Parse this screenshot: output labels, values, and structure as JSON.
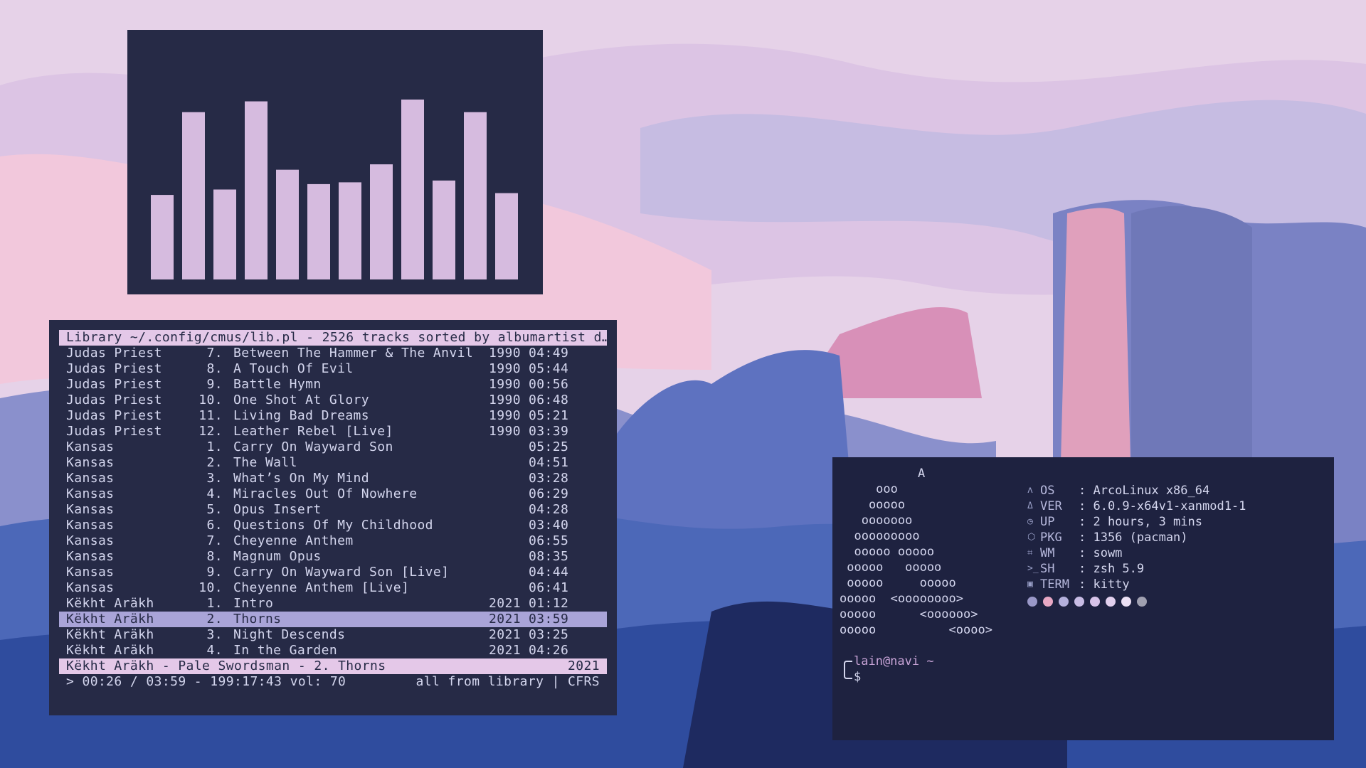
{
  "cmus": {
    "header": "Library ~/.config/cmus/lib.pl - 2526 tracks sorted by albumartist d…",
    "tracks": [
      {
        "artist": "Judas Priest",
        "num": "7.",
        "title": "Between The Hammer & The Anvil",
        "year": "1990",
        "time": "04:49"
      },
      {
        "artist": "Judas Priest",
        "num": "8.",
        "title": "A Touch Of Evil",
        "year": "1990",
        "time": "05:44"
      },
      {
        "artist": "Judas Priest",
        "num": "9.",
        "title": "Battle Hymn",
        "year": "1990",
        "time": "00:56"
      },
      {
        "artist": "Judas Priest",
        "num": "10.",
        "title": "One Shot At Glory",
        "year": "1990",
        "time": "06:48"
      },
      {
        "artist": "Judas Priest",
        "num": "11.",
        "title": "Living Bad Dreams",
        "year": "1990",
        "time": "05:21"
      },
      {
        "artist": "Judas Priest",
        "num": "12.",
        "title": "Leather Rebel [Live]",
        "year": "1990",
        "time": "03:39"
      },
      {
        "artist": "Kansas",
        "num": "1.",
        "title": "Carry On Wayward Son",
        "year": "",
        "time": "05:25"
      },
      {
        "artist": "Kansas",
        "num": "2.",
        "title": "The Wall",
        "year": "",
        "time": "04:51"
      },
      {
        "artist": "Kansas",
        "num": "3.",
        "title": "What’s On My Mind",
        "year": "",
        "time": "03:28"
      },
      {
        "artist": "Kansas",
        "num": "4.",
        "title": "Miracles Out Of Nowhere",
        "year": "",
        "time": "06:29"
      },
      {
        "artist": "Kansas",
        "num": "5.",
        "title": "Opus Insert",
        "year": "",
        "time": "04:28"
      },
      {
        "artist": "Kansas",
        "num": "6.",
        "title": "Questions Of My Childhood",
        "year": "",
        "time": "03:40"
      },
      {
        "artist": "Kansas",
        "num": "7.",
        "title": "Cheyenne Anthem",
        "year": "",
        "time": "06:55"
      },
      {
        "artist": "Kansas",
        "num": "8.",
        "title": "Magnum Opus",
        "year": "",
        "time": "08:35"
      },
      {
        "artist": "Kansas",
        "num": "9.",
        "title": "Carry On Wayward Son [Live]",
        "year": "",
        "time": "04:44"
      },
      {
        "artist": "Kansas",
        "num": "10.",
        "title": "Cheyenne Anthem [Live]",
        "year": "",
        "time": "06:41"
      },
      {
        "artist": "Këkht Aräkh",
        "num": "1.",
        "title": "Intro",
        "year": "2021",
        "time": "01:12"
      },
      {
        "artist": "Këkht Aräkh",
        "num": "2.",
        "title": "Thorns",
        "year": "2021",
        "time": "03:59"
      },
      {
        "artist": "Këkht Aräkh",
        "num": "3.",
        "title": "Night Descends",
        "year": "2021",
        "time": "03:25"
      },
      {
        "artist": "Këkht Aräkh",
        "num": "4.",
        "title": "In the Garden",
        "year": "2021",
        "time": "04:26"
      }
    ],
    "selected_index": 17,
    "now_playing": "Këkht Aräkh - Pale Swordsman - 2. Thorns",
    "now_playing_year": "2021",
    "status_left": "> 00:26 / 03:59 - 199:17:43 vol: 70",
    "status_right": "all from library | CFRS"
  },
  "visualizer": {
    "levels": [
      0.47,
      0.93,
      0.5,
      0.99,
      0.61,
      0.53,
      0.54,
      0.64,
      1.0,
      0.55,
      0.93,
      0.48
    ],
    "bar_color": "#d6bbdf",
    "bg_color": "#262a46"
  },
  "fetch": {
    "logo_letter": "A",
    "logo_lines": [
      "     ooo",
      "    ooooo",
      "   ooooooo",
      "  ooooooooo",
      "  ooooo ooooo",
      " ooooo   ooooo",
      " ooooo     ooooo",
      "ooooo  <oooooooo>",
      "ooooo      <oooooo>",
      "ooooo          <oooo>"
    ],
    "info": [
      {
        "icon": "arch-icon",
        "glyph": "ʌ",
        "label": "OS",
        "value": ": ArcoLinux x86_64"
      },
      {
        "icon": "flame-icon",
        "glyph": "Δ",
        "label": "VER",
        "value": ": 6.0.9-x64v1-xanmod1-1"
      },
      {
        "icon": "clock-icon",
        "glyph": "◷",
        "label": "UP",
        "value": ": 2 hours, 3 mins"
      },
      {
        "icon": "package-icon",
        "glyph": "⬡",
        "label": "PKG",
        "value": ": 1356 (pacman)"
      },
      {
        "icon": "window-icon",
        "glyph": "⌗",
        "label": "WM",
        "value": ": sowm"
      },
      {
        "icon": "shell-icon",
        "glyph": ">_",
        "label": "SH",
        "value": ": zsh 5.9"
      },
      {
        "icon": "terminal-icon",
        "glyph": "▣",
        "label": "TERM",
        "value": ": kitty"
      }
    ],
    "palette": [
      "#9a98c8",
      "#e8a8c4",
      "#b4b0dc",
      "#c8bce4",
      "#d8c4ea",
      "#e2d0ee",
      "#ece0f4",
      "#a0a0b0"
    ],
    "prompt_user": "lain@navi ~",
    "prompt_symbol": "$"
  }
}
